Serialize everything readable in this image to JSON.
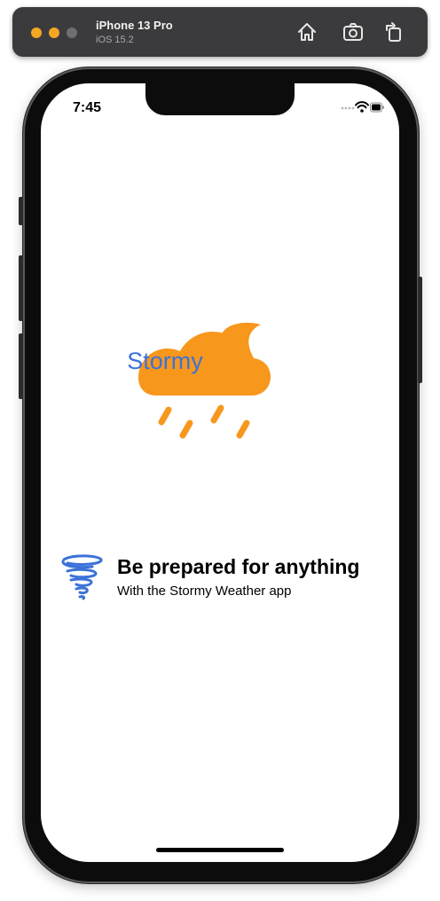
{
  "simulator": {
    "device_name": "iPhone 13 Pro",
    "os_version": "iOS 15.2",
    "traffic_lights": [
      "#f5a623",
      "#f5a623",
      "#6e6e70"
    ]
  },
  "status_bar": {
    "time": "7:45",
    "icons": [
      "wifi-icon",
      "battery-icon"
    ]
  },
  "app": {
    "logo_text": "Stormy",
    "logo_color": "#f7971c",
    "logo_text_color": "#3c72d8",
    "headline": "Be prepared for anything",
    "subheadline": "With the Stormy Weather app",
    "tornado_color": "#3c72d8"
  }
}
